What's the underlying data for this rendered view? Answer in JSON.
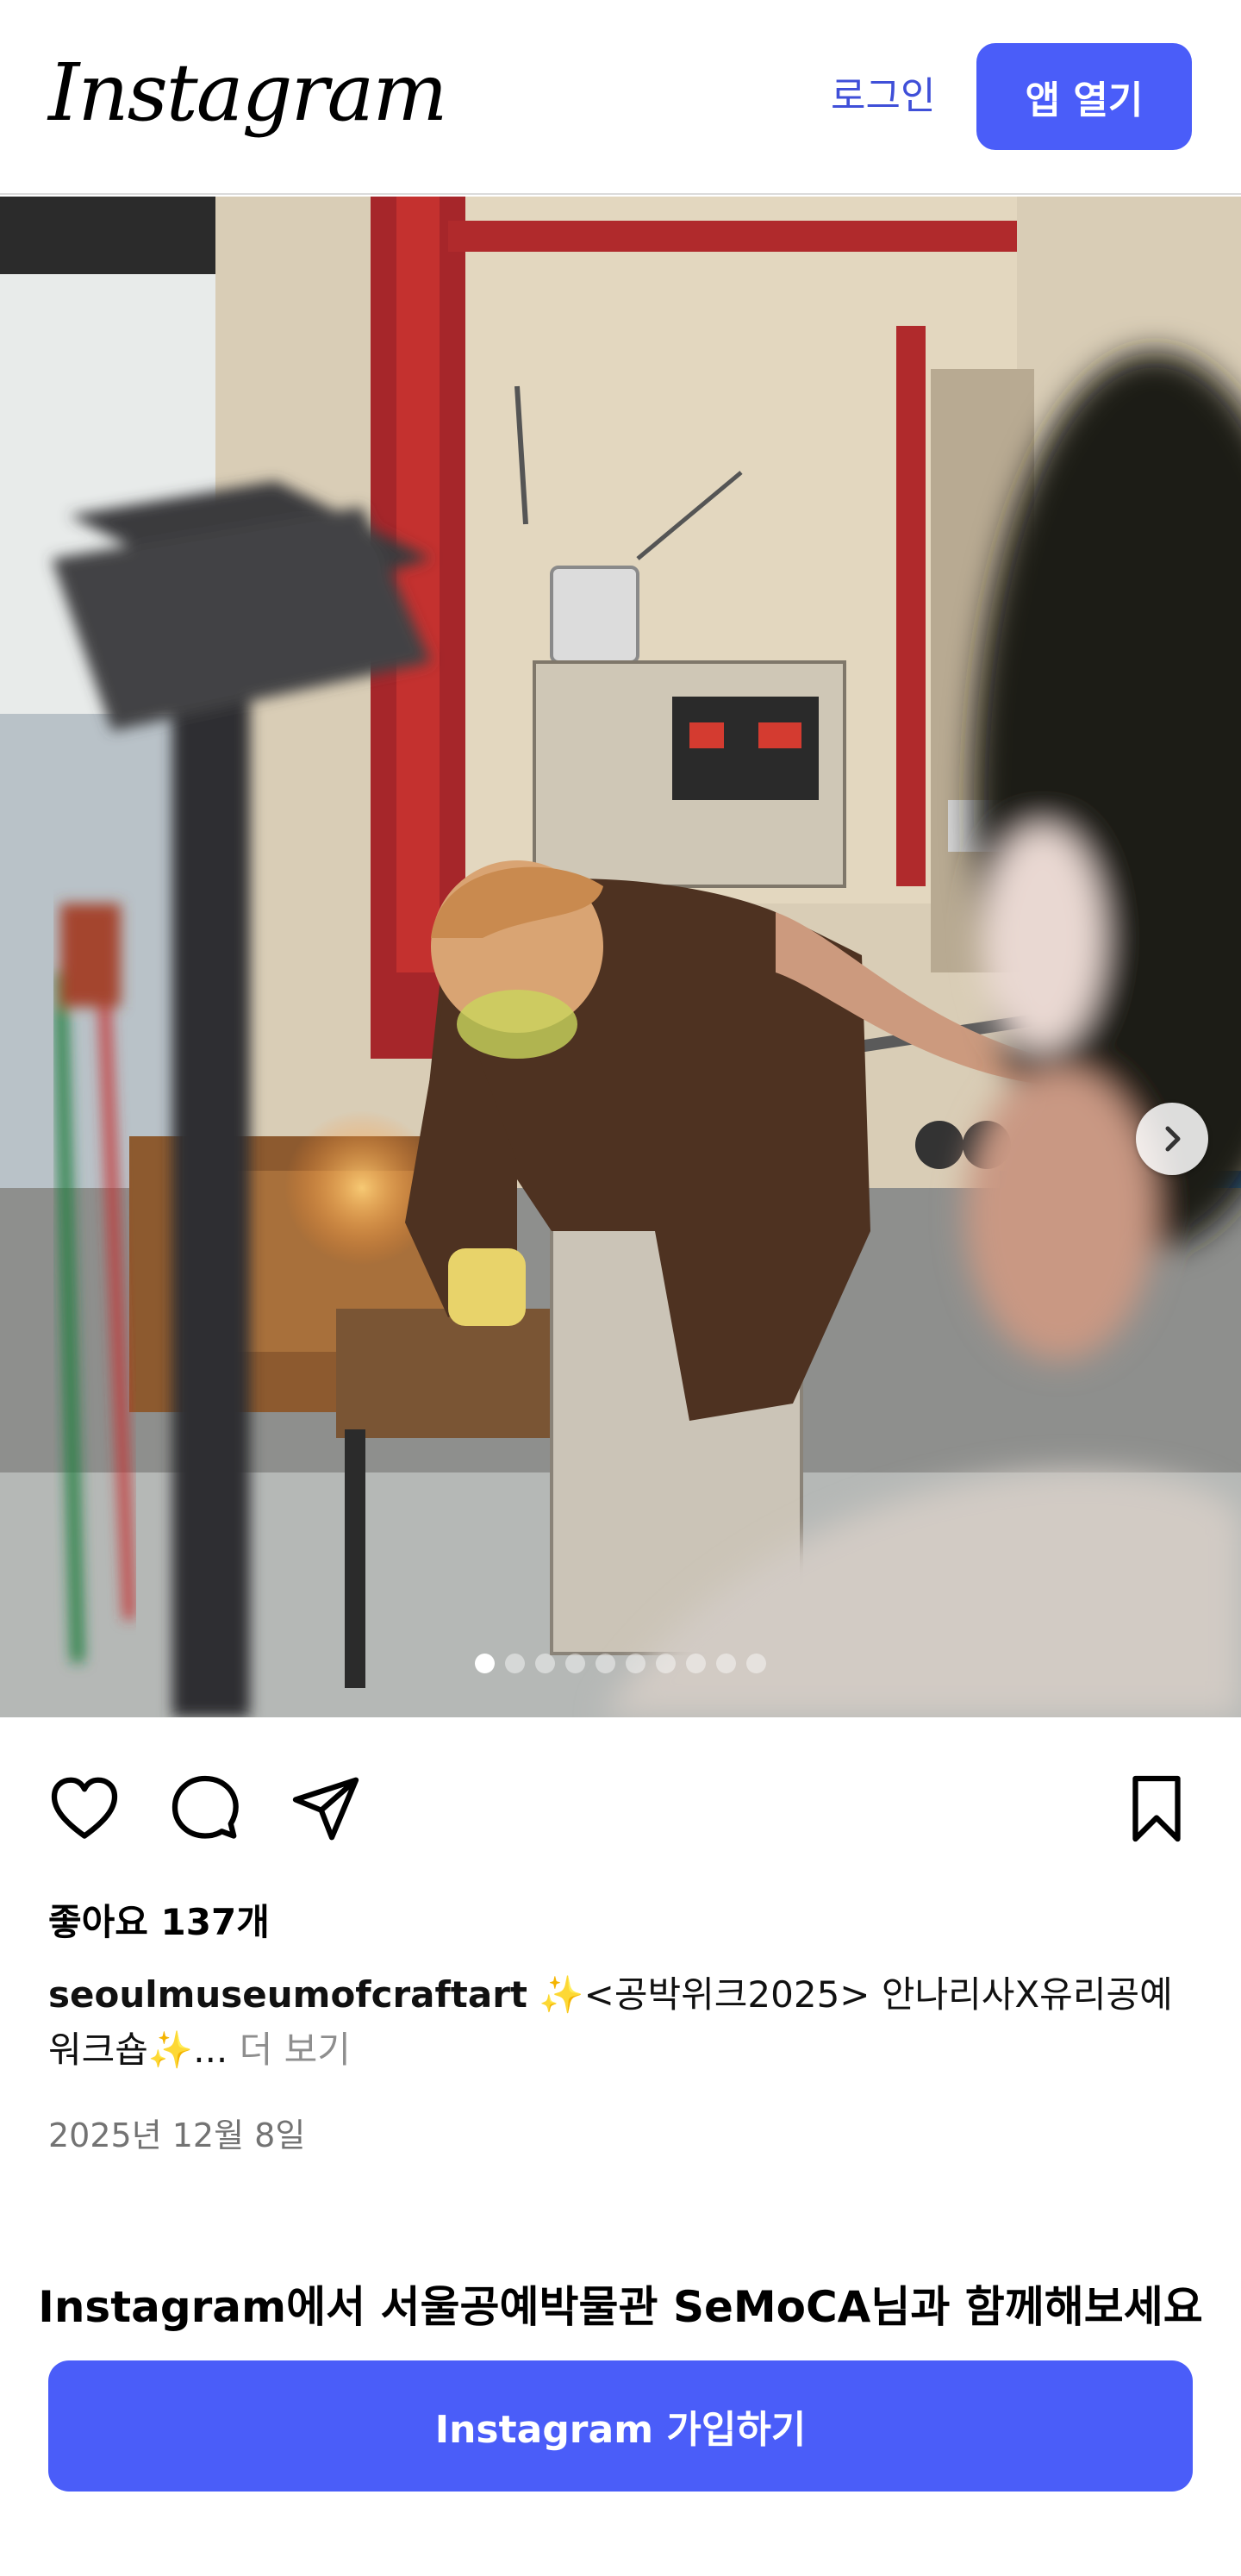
{
  "header": {
    "logo_text": "Instagram",
    "login_label": "로그인",
    "open_app_label": "앱 열기"
  },
  "post": {
    "image": {
      "carousel_total": 10,
      "carousel_active_index": 0,
      "next_icon": "chevron-right-icon"
    },
    "actions": {
      "like_icon": "heart-outline-icon",
      "comment_icon": "comment-bubble-icon",
      "share_icon": "paper-plane-icon",
      "save_icon": "bookmark-outline-icon"
    },
    "likes_text": "좋아요 137개",
    "caption": {
      "username": "seoulmuseumofcraftart",
      "text": " ✨<공박위크2025> 안나리사X유리공예 워크숍✨",
      "ellipsis": "...",
      "more_label": "더 보기"
    },
    "date": "2025년 12월 8일"
  },
  "cta": {
    "title": "Instagram에서 서울공예박물관 SeMoCA님과 함께해보세요",
    "signup_label": "Instagram 가입하기"
  },
  "colors": {
    "accent": "#4a5df9",
    "login_link": "#3f4fd8",
    "muted_text": "#737373"
  }
}
